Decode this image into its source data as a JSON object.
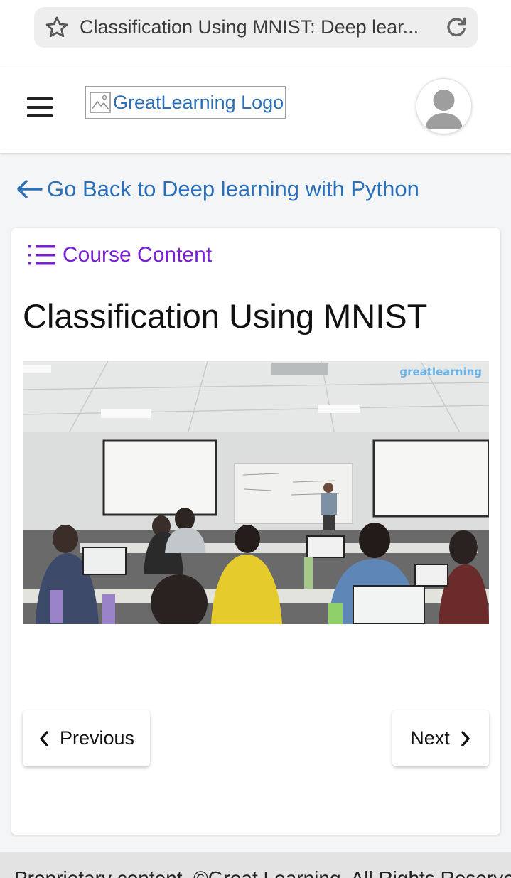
{
  "browser": {
    "tab_title": "Classification Using MNIST: Deep lear...",
    "star_icon": "star-outline-icon",
    "reload_icon": "reload-icon"
  },
  "header": {
    "menu_icon": "hamburger-menu-icon",
    "logo_alt": "GreatLearning Logo",
    "avatar_icon": "user-avatar-icon"
  },
  "nav": {
    "back_label": "Go Back to Deep learning with Python"
  },
  "course": {
    "content_label": "Course Content",
    "lesson_title": "Classification Using MNIST",
    "video_watermark": "greatlearning"
  },
  "pager": {
    "previous_label": "Previous",
    "next_label": "Next"
  },
  "footer": {
    "text": "Proprietary content. ©Great Learning. All Rights Reserved."
  },
  "colors": {
    "link": "#2a6fb8",
    "accent": "#7a1fd6",
    "background": "#f4f5f7"
  }
}
